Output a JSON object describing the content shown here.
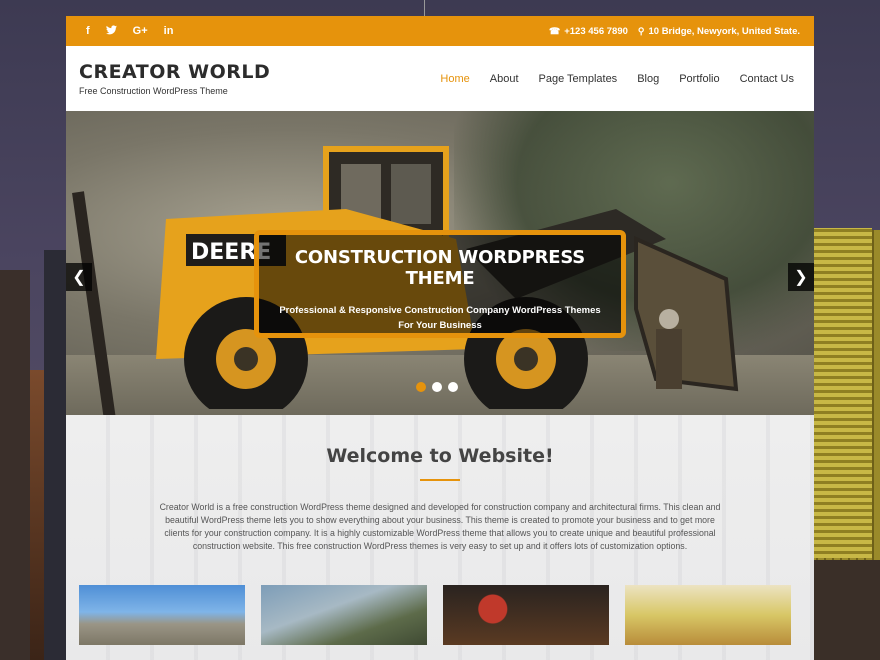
{
  "topbar": {
    "social": [
      {
        "name": "facebook-icon",
        "glyph": "f"
      },
      {
        "name": "twitter-icon",
        "glyph": "t"
      },
      {
        "name": "google-plus-icon",
        "glyph": "G+"
      },
      {
        "name": "linkedin-icon",
        "glyph": "in"
      }
    ],
    "phone_icon": "phone-icon",
    "phone": "+123 456 7890",
    "address_icon": "map-marker-icon",
    "address": "10 Bridge, Newyork, United State."
  },
  "header": {
    "site_title": "CREATOR WORLD",
    "tagline": "Free Construction WordPress Theme"
  },
  "nav": {
    "items": [
      "Home",
      "About",
      "Page Templates",
      "Blog",
      "Portfolio",
      "Contact Us"
    ],
    "active": "Home"
  },
  "slider": {
    "title": "CONSTRUCTION WORDPRESS THEME",
    "subtitle": "Professional & Responsive Construction Company WordPress Themes For Your Business",
    "prev_icon": "chevron-left-icon",
    "next_icon": "chevron-right-icon",
    "slide_count": 3,
    "active_slide": 1
  },
  "welcome": {
    "title": "Welcome to Website!",
    "text": "Creator World is a free construction WordPress theme designed and developed for construction company and architectural firms. This clean and beautiful WordPress theme lets you to show everything about your business. This theme is created to promote your business and to get more clients for your construction company. It is a highly customizable WordPress theme that allows you to create unique and beautiful professional construction website. This free construction WordPress themes is very easy to set up and it offers lots of customization options."
  },
  "colors": {
    "accent": "#e6930c",
    "text_dark": "#2c2c2c"
  }
}
